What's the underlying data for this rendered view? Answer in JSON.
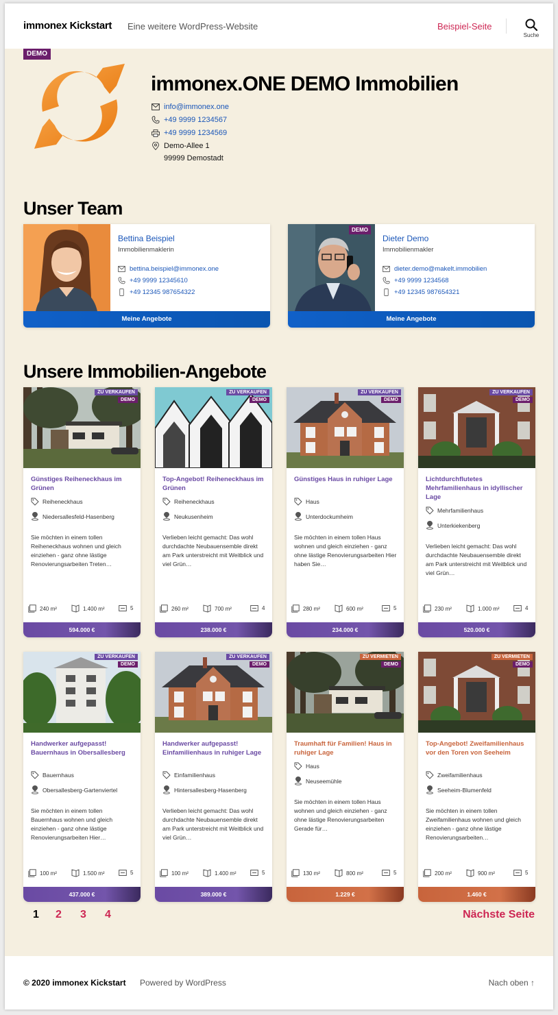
{
  "header": {
    "site_title": "immonex Kickstart",
    "site_description": "Eine weitere WordPress-Website",
    "nav_link": "Beispiel-Seite",
    "search_label": "Suche"
  },
  "agency": {
    "badge": "DEMO",
    "name": "immonex.ONE DEMO Immobilien",
    "email": "info@immonex.one",
    "phone": "+49 9999 1234567",
    "fax": "+49 9999 1234569",
    "street": "Demo-Allee 1",
    "city": "99999 Demostadt"
  },
  "team": {
    "heading": "Unser Team",
    "agents": [
      {
        "name": "Bettina Beispiel",
        "role": "Immobilienmaklerin",
        "email": "bettina.beispiel@immonex.one",
        "phone": "+49 9999 12345610",
        "mobile": "+49 12345 987654322",
        "button": "Meine Angebote",
        "badge": ""
      },
      {
        "name": "Dieter Demo",
        "role": "Immobilienmakler",
        "email": "dieter.demo@makelt.immobilien",
        "phone": "+49 9999 1234568",
        "mobile": "+49 12345 987654321",
        "button": "Meine Angebote",
        "badge": "DEMO"
      }
    ]
  },
  "listings": {
    "heading": "Unsere Immobilien-Angebote",
    "items": [
      {
        "tag": "ZU VERKAUFEN",
        "demo": "DEMO",
        "title": "Günstiges Reiheneckhaus im Grünen",
        "type": "Reiheneckhaus",
        "location": "Niedersallesfeld-Hasenberg",
        "description": "Sie möchten in einem tollen Reiheneckhaus wohnen und gleich einziehen - ganz ohne lästige Renovierungsarbeiten Treten…",
        "living": "240 m²",
        "plot": "1.400 m²",
        "rooms": "5",
        "price": "594.000 €"
      },
      {
        "tag": "ZU VERKAUFEN",
        "demo": "DEMO",
        "title": "Top-Angebot! Reiheneckhaus im Grünen",
        "type": "Reiheneckhaus",
        "location": "Neukusenheim",
        "description": "Verlieben leicht gemacht: Das wohl durchdachte Neubauensemble direkt am Park unterstreicht mit Weitblick und viel Grün…",
        "living": "260 m²",
        "plot": "700 m²",
        "rooms": "4",
        "price": "238.000 €"
      },
      {
        "tag": "ZU VERKAUFEN",
        "demo": "DEMO",
        "title": "Günstiges Haus in ruhiger Lage",
        "type": "Haus",
        "location": "Unterdockumheim",
        "description": "Sie möchten in einem tollen Haus wohnen und gleich einziehen - ganz ohne lästige Renovierungsarbeiten Hier haben Sie…",
        "living": "280 m²",
        "plot": "600 m²",
        "rooms": "5",
        "price": "234.000 €"
      },
      {
        "tag": "ZU VERKAUFEN",
        "demo": "DEMO",
        "title": "Lichtdurchflutetes Mehrfamilienhaus in idyllischer Lage",
        "type": "Mehrfamilienhaus",
        "location": "Unterkiekenberg",
        "description": "Verlieben leicht gemacht: Das wohl durchdachte Neubauensemble direkt am Park unterstreicht mit Weitblick und viel Grün…",
        "living": "230 m²",
        "plot": "1.000 m²",
        "rooms": "4",
        "price": "520.000 €"
      },
      {
        "tag": "ZU VERKAUFEN",
        "demo": "DEMO",
        "title": "Handwerker aufgepasst! Bauernhaus in Obersallesberg",
        "type": "Bauernhaus",
        "location": "Obersallesberg-Gartenviertel",
        "description": "Sie möchten in einem tollen Bauernhaus wohnen und gleich einziehen - ganz ohne lästige Renovierungsarbeiten Hier…",
        "living": "100 m²",
        "plot": "1.500 m²",
        "rooms": "5",
        "price": "437.000 €"
      },
      {
        "tag": "ZU VERKAUFEN",
        "demo": "DEMO",
        "title": "Handwerker aufgepasst! Einfamilienhaus in ruhiger Lage",
        "type": "Einfamilienhaus",
        "location": "Hintersallesberg-Hasenberg",
        "description": "Verlieben leicht gemacht: Das wohl durchdachte Neubauensemble direkt am Park unterstreicht mit Weitblick und viel Grün…",
        "living": "100 m²",
        "plot": "1.400 m²",
        "rooms": "5",
        "price": "389.000 €"
      },
      {
        "tag": "ZU VERMIETEN",
        "demo": "DEMO",
        "title": "Traumhaft für Familien! Haus in ruhiger Lage",
        "type": "Haus",
        "location": "Neuseemühle",
        "description": "Sie möchten in einem tollen Haus wohnen und gleich einziehen - ganz ohne lästige Renovierungsarbeiten Gerade für…",
        "living": "130 m²",
        "plot": "800 m²",
        "rooms": "5",
        "price": "1.229 €"
      },
      {
        "tag": "ZU VERMIETEN",
        "demo": "DEMO",
        "title": "Top-Angebot! Zweifamilienhaus vor den Toren von Seeheim",
        "type": "Zweifamilienhaus",
        "location": "Seeheim-Blumenfeld",
        "description": "Sie möchten in einem tollen Zweifamilienhaus wohnen und gleich einziehen - ganz ohne lästige Renovierungsarbeiten…",
        "living": "200 m²",
        "plot": "900 m²",
        "rooms": "5",
        "price": "1.460 €"
      }
    ]
  },
  "pagination": {
    "pages": [
      "1",
      "2",
      "3",
      "4"
    ],
    "current": "1",
    "next": "Nächste Seite"
  },
  "footer": {
    "copyright": "© 2020 immonex Kickstart",
    "powered": "Powered by WordPress",
    "top": "Nach oben ↑"
  },
  "colors": {
    "accent": "#cd2653",
    "link": "#1a56b8",
    "sale": "#6a4aa3",
    "rent": "#c8643c",
    "demo_badge": "#6b1e6b",
    "agent_button": "#1060c8",
    "background": "#f5efe0"
  }
}
